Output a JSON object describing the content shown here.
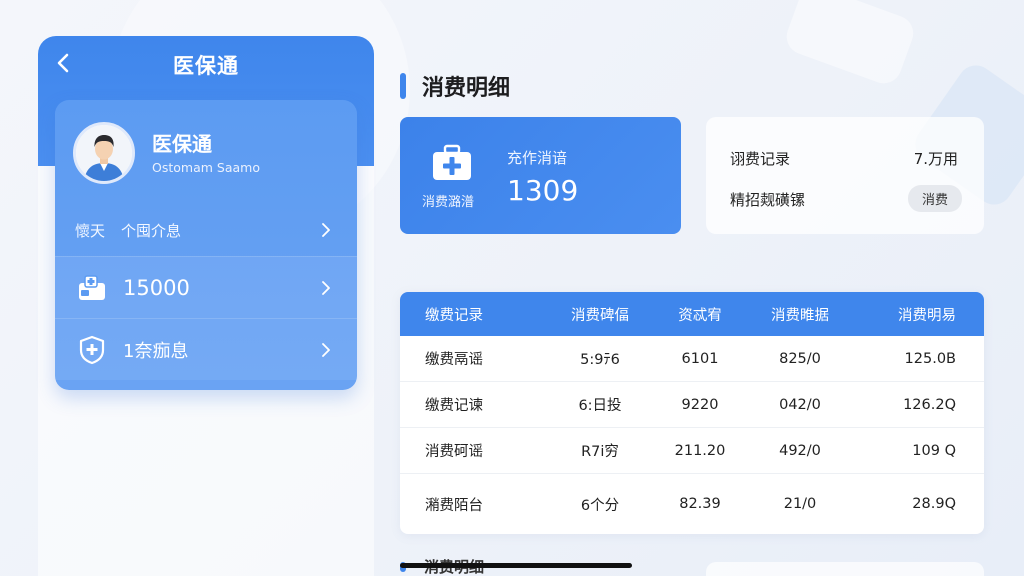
{
  "app": {
    "title": "医保通",
    "back_icon": "chevron-left-icon"
  },
  "profile": {
    "name": "医保通",
    "subtitle": "Ostomam Saamo",
    "avatar_icon": "user-avatar-icon"
  },
  "menu": [
    {
      "label_a": "懷天",
      "label_b": "个囤介息",
      "icon": "",
      "chevron": "chevron-right-icon"
    },
    {
      "label": "15000",
      "icon": "medical-wallet-icon",
      "chevron": "chevron-right-icon"
    },
    {
      "label": "1奈痂息",
      "icon": "shield-plus-icon",
      "chevron": "chevron-right-icon"
    }
  ],
  "section": {
    "title": "消费明细"
  },
  "stat_card": {
    "icon": "medical-kit-icon",
    "icon_label": "消费潞潽",
    "label": "充作消谙",
    "value": "1309"
  },
  "info_card": {
    "row1_label": "诩费记录",
    "row1_value": "7.万用",
    "row2_label": "精招觌磺镙",
    "badge": "消费"
  },
  "table": {
    "headers": [
      "缴费记录",
      "消费碑偪",
      "资忒宥",
      "消费睢据",
      "消费明易"
    ],
    "rows": [
      [
        "缴费鬲谣",
        "5:9ﾃ6",
        "6101",
        "825/0",
        "125.0B"
      ],
      [
        "缴费记谏",
        "6:日投",
        "9220",
        "042/0",
        "126.2Q"
      ],
      [
        "消费砢谣",
        "R7i穷",
        "211.20",
        "492/0",
        "109 Q"
      ],
      [
        "潲费陌台",
        "6个分",
        "82.39",
        "21/0",
        "28.9Q"
      ]
    ]
  },
  "bottom_section": {
    "title": "消费明细"
  },
  "colors": {
    "primary": "#3f86ec",
    "card_light": "#ffffff",
    "badge_bg": "#e6e9ee"
  }
}
